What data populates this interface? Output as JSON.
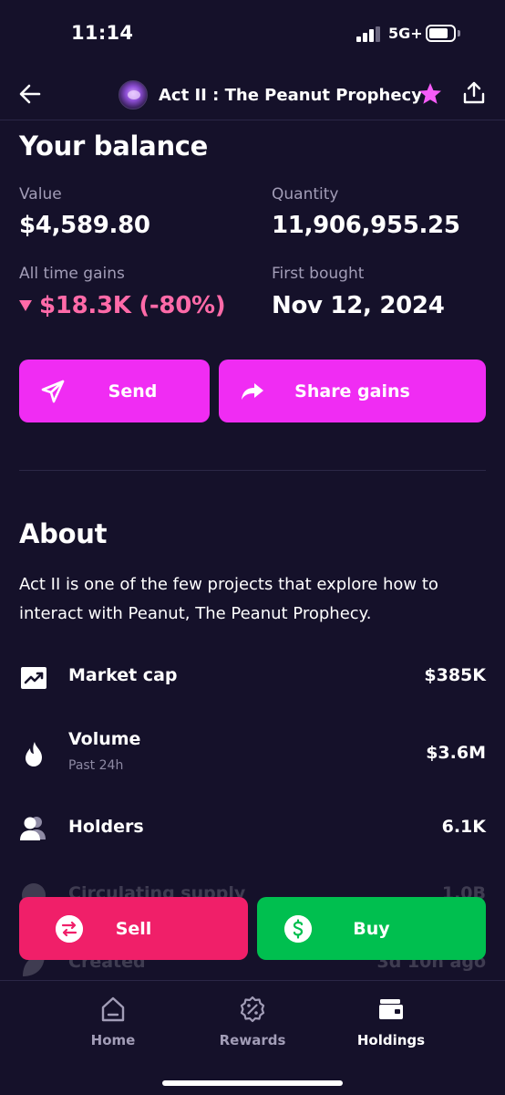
{
  "status_bar": {
    "time": "11:14",
    "network": "5G+"
  },
  "header": {
    "title": "Act II : The Peanut Prophecy"
  },
  "balance": {
    "heading": "Your balance",
    "value_label": "Value",
    "value": "$4,589.80",
    "quantity_label": "Quantity",
    "quantity": "11,906,955.25",
    "gains_label": "All time gains",
    "gains": "$18.3K (-80%)",
    "first_bought_label": "First bought",
    "first_bought": "Nov 12, 2024"
  },
  "actions": {
    "send_label": "Send",
    "share_label": "Share gains"
  },
  "about": {
    "heading": "About",
    "description": "Act II is one of the few projects that explore how to interact with Peanut, The Peanut Prophecy."
  },
  "stats": [
    {
      "label": "Market cap",
      "value": "$385K",
      "icon": "chart-up-icon"
    },
    {
      "label": "Volume",
      "sublabel": "Past 24h",
      "value": "$3.6M",
      "icon": "flame-icon"
    },
    {
      "label": "Holders",
      "value": "6.1K",
      "icon": "users-icon"
    },
    {
      "label": "Circulating supply",
      "value": "1.0B",
      "icon": "pie-chart-icon"
    },
    {
      "label": "Created",
      "value": "3d 10h ago",
      "icon": "leaf-icon"
    }
  ],
  "trade": {
    "sell_label": "Sell",
    "buy_label": "Buy"
  },
  "tabs": [
    {
      "label": "Home",
      "icon": "home-icon",
      "active": false
    },
    {
      "label": "Rewards",
      "icon": "rewards-icon",
      "active": false
    },
    {
      "label": "Holdings",
      "icon": "wallet-icon",
      "active": true
    }
  ],
  "colors": {
    "background": "#15112a",
    "accent": "#f02cf3",
    "sell": "#f01f69",
    "buy": "#00bf4f",
    "loss": "#ff6aa8",
    "favorite_star": "#f65cf9"
  }
}
